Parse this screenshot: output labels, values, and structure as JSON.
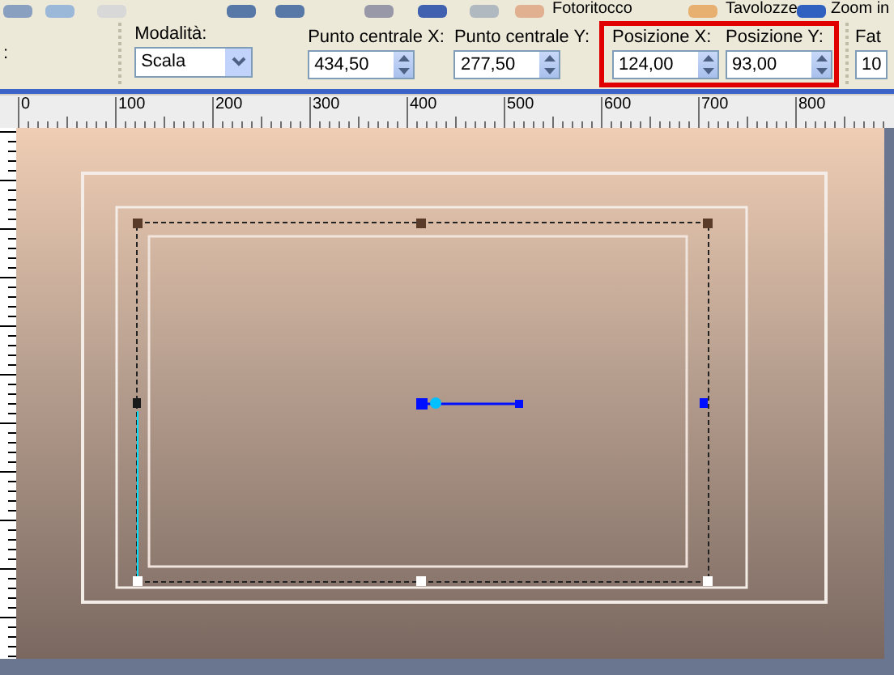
{
  "menu": [
    {
      "label": "Fotoritocco"
    },
    {
      "label": "Tavolozze"
    },
    {
      "label": "Zoom in"
    }
  ],
  "options": {
    "cut_label": ":",
    "mode": {
      "label": "Modalità:",
      "value": "Scala"
    },
    "field_groups": [
      {
        "highlighted": false,
        "fields": [
          {
            "label": "Punto centrale X:",
            "value": "434,50"
          },
          {
            "label": "Punto centrale Y:",
            "value": "277,50"
          }
        ]
      },
      {
        "highlighted": true,
        "fields": [
          {
            "label": "Posizione X:",
            "value": "124,00"
          },
          {
            "label": "Posizione Y:",
            "value": "93,00"
          }
        ]
      }
    ],
    "cut_field": {
      "label": "Fat",
      "value": "10"
    }
  },
  "ruler": {
    "labels": [
      "0",
      "100",
      "200",
      "300",
      "400",
      "500",
      "600",
      "700",
      "800"
    ]
  }
}
